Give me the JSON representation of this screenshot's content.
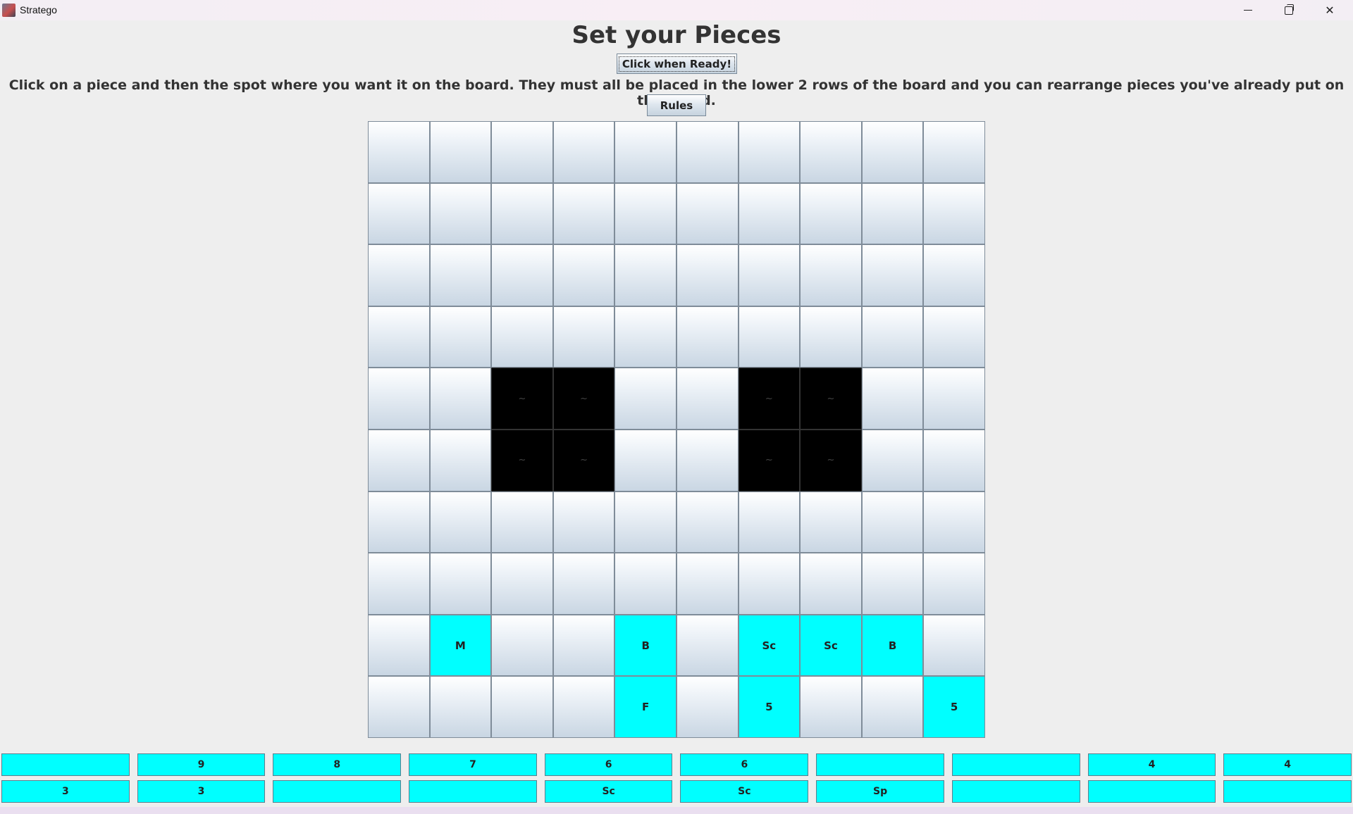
{
  "window": {
    "title": "Stratego"
  },
  "header": {
    "title": "Set your Pieces",
    "ready_button": "Click when Ready!",
    "instructions": "Click on a piece and then the spot where you want it on the board. They must all be placed in the lower 2 rows of the board and you can rearrange pieces you've already put on the board.",
    "rules_button": "Rules"
  },
  "board": {
    "rows": [
      [
        "",
        "",
        "",
        "",
        "",
        "",
        "",
        "",
        "",
        ""
      ],
      [
        "",
        "",
        "",
        "",
        "",
        "",
        "",
        "",
        "",
        ""
      ],
      [
        "",
        "",
        "",
        "",
        "",
        "",
        "",
        "",
        "",
        ""
      ],
      [
        "",
        "",
        "",
        "",
        "",
        "",
        "",
        "",
        "",
        ""
      ],
      [
        "",
        "",
        "~",
        "~",
        "",
        "",
        "~",
        "~",
        "",
        ""
      ],
      [
        "",
        "",
        "~",
        "~",
        "",
        "",
        "~",
        "~",
        "",
        ""
      ],
      [
        "",
        "",
        "",
        "",
        "",
        "",
        "",
        "",
        "",
        ""
      ],
      [
        "",
        "",
        "",
        "",
        "",
        "",
        "",
        "",
        "",
        ""
      ],
      [
        "",
        "M",
        "",
        "",
        "B",
        "",
        "Sc",
        "Sc",
        "B",
        ""
      ],
      [
        "",
        "",
        "",
        "",
        "F",
        "",
        "5",
        "",
        "",
        "5"
      ]
    ],
    "types": [
      [
        "e",
        "e",
        "e",
        "e",
        "e",
        "e",
        "e",
        "e",
        "e",
        "e"
      ],
      [
        "e",
        "e",
        "e",
        "e",
        "e",
        "e",
        "e",
        "e",
        "e",
        "e"
      ],
      [
        "e",
        "e",
        "e",
        "e",
        "e",
        "e",
        "e",
        "e",
        "e",
        "e"
      ],
      [
        "e",
        "e",
        "e",
        "e",
        "e",
        "e",
        "e",
        "e",
        "e",
        "e"
      ],
      [
        "e",
        "e",
        "lake",
        "lake",
        "e",
        "e",
        "lake",
        "lake",
        "e",
        "e"
      ],
      [
        "e",
        "e",
        "lake",
        "lake",
        "e",
        "e",
        "lake",
        "lake",
        "e",
        "e"
      ],
      [
        "e",
        "e",
        "e",
        "e",
        "e",
        "e",
        "e",
        "e",
        "e",
        "e"
      ],
      [
        "e",
        "e",
        "e",
        "e",
        "e",
        "e",
        "e",
        "e",
        "e",
        "e"
      ],
      [
        "e",
        "placed",
        "e",
        "e",
        "placed",
        "e",
        "placed",
        "placed",
        "placed",
        "e"
      ],
      [
        "e",
        "e",
        "e",
        "e",
        "placed",
        "e",
        "placed",
        "e",
        "e",
        "placed"
      ]
    ]
  },
  "tray": {
    "row1": [
      "",
      "9",
      "8",
      "7",
      "6",
      "6",
      "",
      "",
      "4",
      "4"
    ],
    "row2": [
      "3",
      "3",
      "",
      "",
      "Sc",
      "Sc",
      "Sp",
      "",
      "",
      ""
    ]
  },
  "colors": {
    "placed_piece": "#00ffff",
    "lake": "#000000",
    "background": "#eeeeee"
  }
}
